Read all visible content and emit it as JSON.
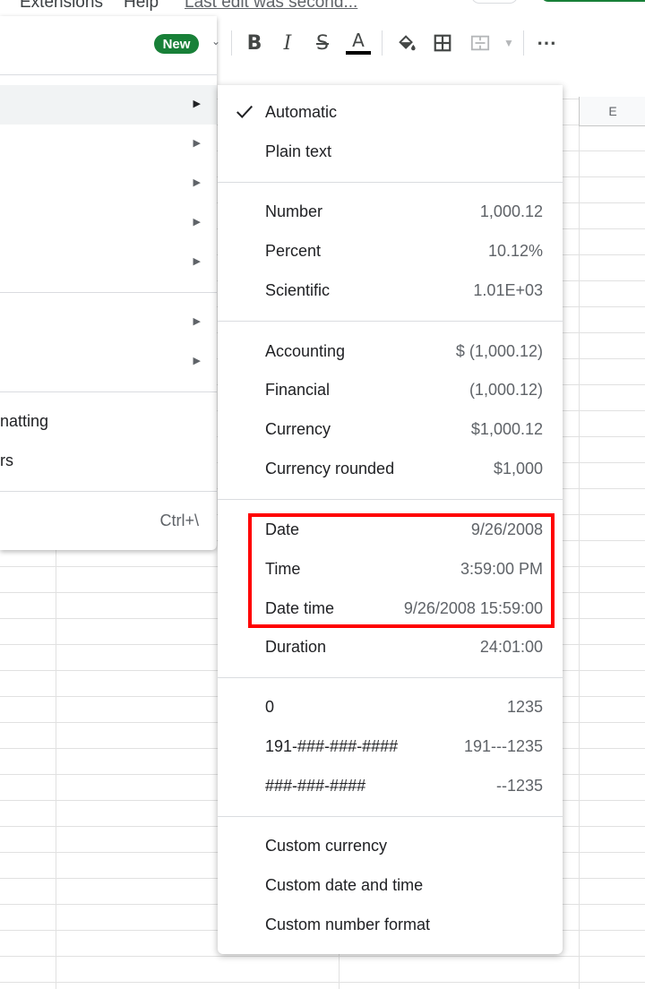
{
  "menubar": {
    "extensions": "Extensions",
    "help": "Help",
    "last_edit": "Last edit was second..."
  },
  "toolbar": {
    "bold": "B",
    "italic": "I",
    "strike": "S",
    "text_color": "A",
    "more": "⋯"
  },
  "grid": {
    "column_e": "E"
  },
  "left_menu": {
    "new_badge": "New",
    "conditional_formatting_partial": "natting",
    "alternating_colors_partial": "rs",
    "clear_formatting_shortcut": "Ctrl+\\"
  },
  "number_menu": {
    "groups": [
      [
        {
          "label": "Automatic",
          "value": "",
          "checked": true
        },
        {
          "label": "Plain text",
          "value": ""
        }
      ],
      [
        {
          "label": "Number",
          "value": "1,000.12"
        },
        {
          "label": "Percent",
          "value": "10.12%"
        },
        {
          "label": "Scientific",
          "value": "1.01E+03"
        }
      ],
      [
        {
          "label": "Accounting",
          "value": "$ (1,000.12)"
        },
        {
          "label": "Financial",
          "value": "(1,000.12)"
        },
        {
          "label": "Currency",
          "value": "$1,000.12"
        },
        {
          "label": "Currency rounded",
          "value": "$1,000"
        }
      ],
      [
        {
          "label": "Date",
          "value": "9/26/2008"
        },
        {
          "label": "Time",
          "value": "3:59:00 PM"
        },
        {
          "label": "Date time",
          "value": "9/26/2008 15:59:00"
        },
        {
          "label": "Duration",
          "value": "24:01:00"
        }
      ],
      [
        {
          "label": "0",
          "value": "1235"
        },
        {
          "label": "191-###-###-####",
          "value": "191---1235"
        },
        {
          "label": "###-###-####",
          "value": "--1235"
        }
      ],
      [
        {
          "label": "Custom currency",
          "value": ""
        },
        {
          "label": "Custom date and time",
          "value": ""
        },
        {
          "label": "Custom number format",
          "value": ""
        }
      ]
    ]
  },
  "colors": {
    "accent_green": "#188038",
    "highlight_red": "#ff0000",
    "text_primary": "#202124",
    "text_secondary": "#5f6368"
  }
}
